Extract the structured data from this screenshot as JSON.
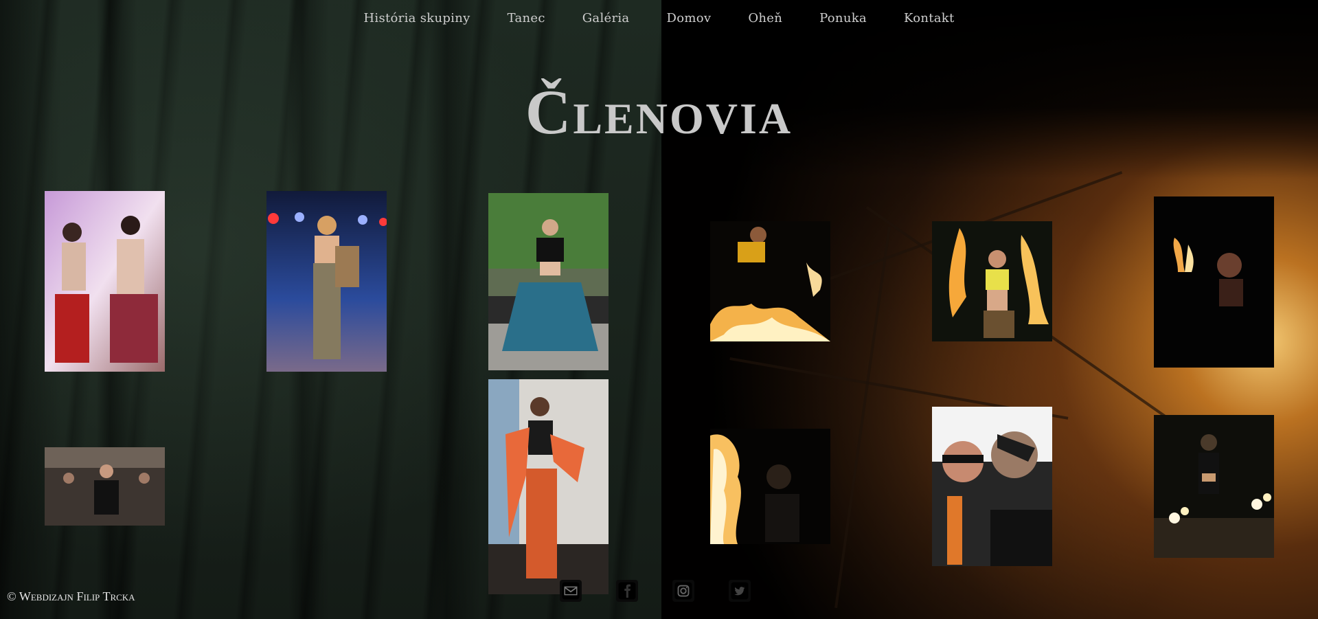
{
  "nav": {
    "items": [
      {
        "label": "História skupiny"
      },
      {
        "label": "Tanec"
      },
      {
        "label": "Galéria"
      },
      {
        "label": "Domov"
      },
      {
        "label": "Oheň"
      },
      {
        "label": "Ponuka"
      },
      {
        "label": "Kontakt"
      }
    ]
  },
  "page": {
    "title": "Členovia"
  },
  "footer": {
    "copyright": "© Webdizajn Filip Trcka",
    "social": [
      "email-icon",
      "facebook-icon",
      "instagram-icon",
      "twitter-icon"
    ]
  },
  "colors": {
    "nav_text": "#cfcfcf",
    "title": "#c9c9c9",
    "fire": "#f2a23a"
  }
}
